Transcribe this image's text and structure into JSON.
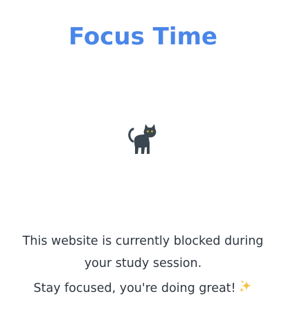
{
  "header": {
    "title": "Focus Time"
  },
  "illustration": {
    "icon": "black-cat-icon"
  },
  "message": {
    "blocked_text": "This website is currently blocked during your study session.",
    "encouragement_text": "Stay focused, you're doing great!",
    "encouragement_icon": "sparkles-icon"
  },
  "colors": {
    "title": "#4a86e8",
    "text": "#2f3640",
    "cat_body": "#3b4750",
    "cat_eyes": "#f3c623",
    "sparkle": "#f5c242",
    "background": "#ffffff"
  }
}
